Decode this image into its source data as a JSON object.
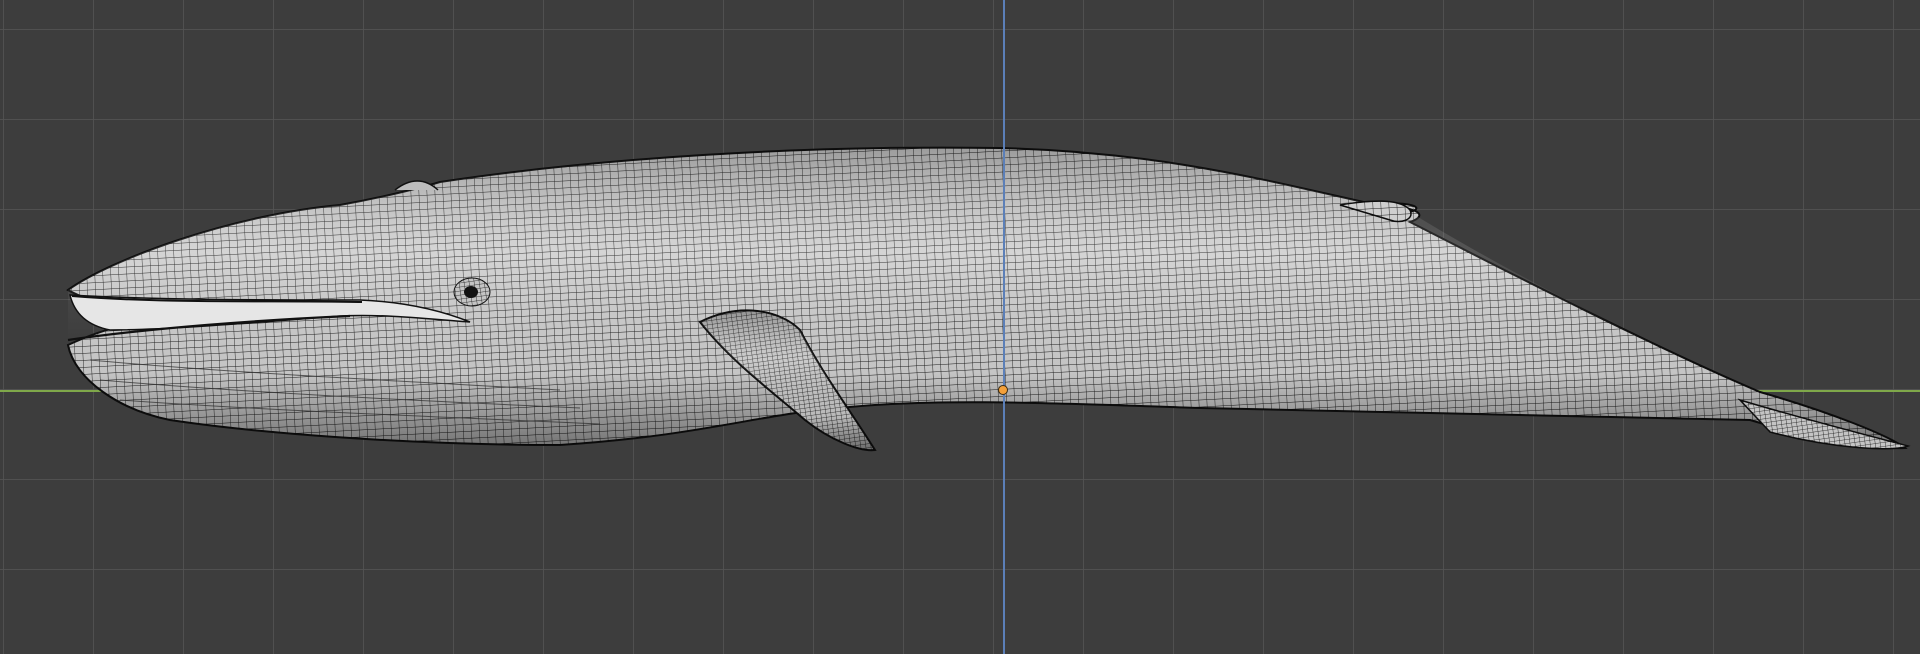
{
  "viewport": {
    "editor": "3D Viewport",
    "view": "side-orthographic",
    "shading": "solid-wireframe",
    "grid": true,
    "colors": {
      "background": "#3d3d3d",
      "grid": "#545454",
      "axis_x": "#7fa84a",
      "axis_z": "#5b7fb8",
      "origin": "#f3a03a",
      "mesh_surface": "#cfcfcf",
      "mesh_wire": "#1c1c1c"
    }
  },
  "scene_object": {
    "icon": "whale-mesh-icon",
    "type": "mesh",
    "origin_marker": "object-origin-dot"
  }
}
